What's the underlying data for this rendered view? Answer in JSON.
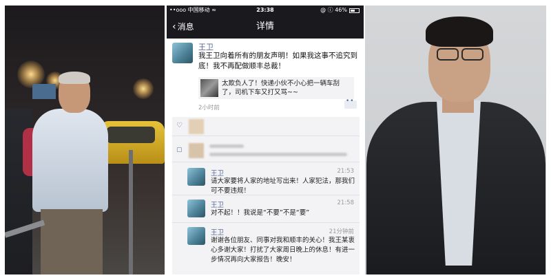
{
  "status_bar": {
    "carrier": "••ooo 中国移动 ≈",
    "time": "23:38",
    "battery_text": "@ ⓘ 46%"
  },
  "nav": {
    "back_label": "消息",
    "title": "详情"
  },
  "post": {
    "author": "王卫",
    "text": "我王卫向着所有的朋友声明！如果我这事不追究到底！我不再配做顺丰总裁！",
    "link_text": "太欺负人了！快递小伙不小心把一辆车刮了，司机下车又打又骂~~",
    "time_ago": "2小时前"
  },
  "comments": [
    {
      "name": "王卫",
      "time": "21:53",
      "text": "请大家要将人家的地址写出来！人家犯法，那我们可不要违规！"
    },
    {
      "name": "王卫",
      "time": "21:58",
      "text": "对不起！！我说是“不要”不是“要”"
    },
    {
      "name": "王卫",
      "time": "21分钟前",
      "text": "谢谢各位朋友、同事对我和顺丰的关心！我王某衷心多谢大家！打扰了大家周日晚上的休息！有进一步情况再向大家报告！晚安！"
    }
  ],
  "colors": {
    "link_blue": "#576b95",
    "phone_header": "#1a1a1e"
  }
}
